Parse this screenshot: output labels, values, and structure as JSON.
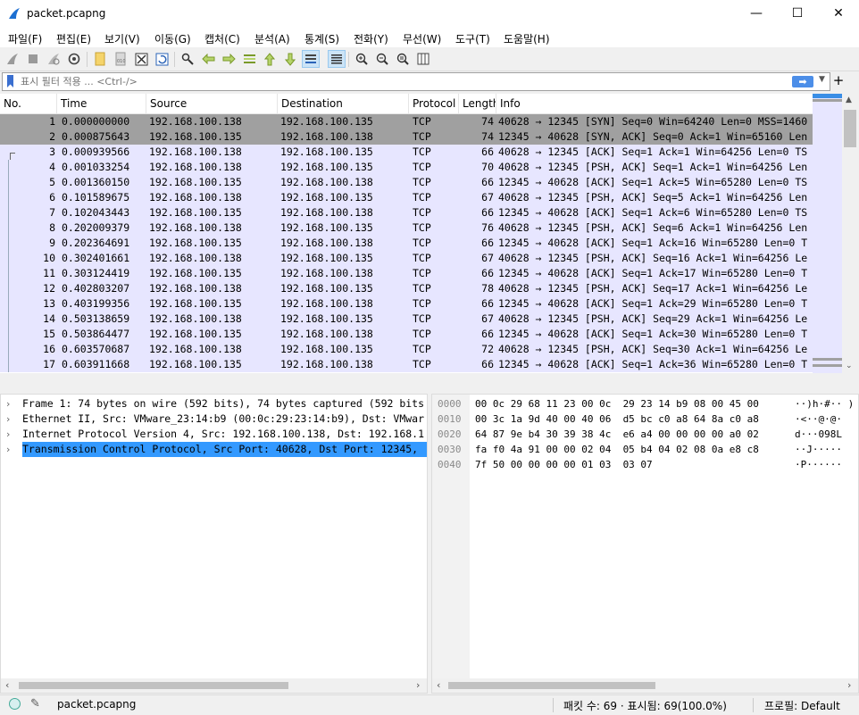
{
  "window": {
    "title": "packet.pcapng",
    "controls": {
      "minimize": "—",
      "maximize": "☐",
      "close": "✕"
    }
  },
  "menu": [
    "파일(F)",
    "편집(E)",
    "보기(V)",
    "이동(G)",
    "캡처(C)",
    "분석(A)",
    "통계(S)",
    "전화(Y)",
    "무선(W)",
    "도구(T)",
    "도움말(H)"
  ],
  "filter": {
    "placeholder": "표시 필터 적용 ... <Ctrl-/>",
    "apply_label": "➡",
    "add_label": "+"
  },
  "columns": [
    "No.",
    "Time",
    "Source",
    "Destination",
    "Protocol",
    "Length",
    "Info"
  ],
  "packets": [
    {
      "no": "1",
      "time": "0.000000000",
      "src": "192.168.100.138",
      "dst": "192.168.100.135",
      "proto": "TCP",
      "len": "74",
      "info": "40628 → 12345 [SYN] Seq=0 Win=64240 Len=0 MSS=1460",
      "style": "dark"
    },
    {
      "no": "2",
      "time": "0.000875643",
      "src": "192.168.100.135",
      "dst": "192.168.100.138",
      "proto": "TCP",
      "len": "74",
      "info": "12345 → 40628 [SYN, ACK] Seq=0 Ack=1 Win=65160 Len",
      "style": "dark"
    },
    {
      "no": "3",
      "time": "0.000939566",
      "src": "192.168.100.138",
      "dst": "192.168.100.135",
      "proto": "TCP",
      "len": "66",
      "info": "40628 → 12345 [ACK] Seq=1 Ack=1 Win=64256 Len=0 TS",
      "style": "normal"
    },
    {
      "no": "4",
      "time": "0.001033254",
      "src": "192.168.100.138",
      "dst": "192.168.100.135",
      "proto": "TCP",
      "len": "70",
      "info": "40628 → 12345 [PSH, ACK] Seq=1 Ack=1 Win=64256 Len",
      "style": "normal"
    },
    {
      "no": "5",
      "time": "0.001360150",
      "src": "192.168.100.135",
      "dst": "192.168.100.138",
      "proto": "TCP",
      "len": "66",
      "info": "12345 → 40628 [ACK] Seq=1 Ack=5 Win=65280 Len=0 TS",
      "style": "normal"
    },
    {
      "no": "6",
      "time": "0.101589675",
      "src": "192.168.100.138",
      "dst": "192.168.100.135",
      "proto": "TCP",
      "len": "67",
      "info": "40628 → 12345 [PSH, ACK] Seq=5 Ack=1 Win=64256 Len",
      "style": "normal"
    },
    {
      "no": "7",
      "time": "0.102043443",
      "src": "192.168.100.135",
      "dst": "192.168.100.138",
      "proto": "TCP",
      "len": "66",
      "info": "12345 → 40628 [ACK] Seq=1 Ack=6 Win=65280 Len=0 TS",
      "style": "normal"
    },
    {
      "no": "8",
      "time": "0.202009379",
      "src": "192.168.100.138",
      "dst": "192.168.100.135",
      "proto": "TCP",
      "len": "76",
      "info": "40628 → 12345 [PSH, ACK] Seq=6 Ack=1 Win=64256 Len",
      "style": "normal"
    },
    {
      "no": "9",
      "time": "0.202364691",
      "src": "192.168.100.135",
      "dst": "192.168.100.138",
      "proto": "TCP",
      "len": "66",
      "info": "12345 → 40628 [ACK] Seq=1 Ack=16 Win=65280 Len=0 T",
      "style": "normal"
    },
    {
      "no": "10",
      "time": "0.302401661",
      "src": "192.168.100.138",
      "dst": "192.168.100.135",
      "proto": "TCP",
      "len": "67",
      "info": "40628 → 12345 [PSH, ACK] Seq=16 Ack=1 Win=64256 Le",
      "style": "normal"
    },
    {
      "no": "11",
      "time": "0.303124419",
      "src": "192.168.100.135",
      "dst": "192.168.100.138",
      "proto": "TCP",
      "len": "66",
      "info": "12345 → 40628 [ACK] Seq=1 Ack=17 Win=65280 Len=0 T",
      "style": "normal"
    },
    {
      "no": "12",
      "time": "0.402803207",
      "src": "192.168.100.138",
      "dst": "192.168.100.135",
      "proto": "TCP",
      "len": "78",
      "info": "40628 → 12345 [PSH, ACK] Seq=17 Ack=1 Win=64256 Le",
      "style": "normal"
    },
    {
      "no": "13",
      "time": "0.403199356",
      "src": "192.168.100.135",
      "dst": "192.168.100.138",
      "proto": "TCP",
      "len": "66",
      "info": "12345 → 40628 [ACK] Seq=1 Ack=29 Win=65280 Len=0 T",
      "style": "normal"
    },
    {
      "no": "14",
      "time": "0.503138659",
      "src": "192.168.100.138",
      "dst": "192.168.100.135",
      "proto": "TCP",
      "len": "67",
      "info": "40628 → 12345 [PSH, ACK] Seq=29 Ack=1 Win=64256 Le",
      "style": "normal"
    },
    {
      "no": "15",
      "time": "0.503864477",
      "src": "192.168.100.135",
      "dst": "192.168.100.138",
      "proto": "TCP",
      "len": "66",
      "info": "12345 → 40628 [ACK] Seq=1 Ack=30 Win=65280 Len=0 T",
      "style": "normal"
    },
    {
      "no": "16",
      "time": "0.603570687",
      "src": "192.168.100.138",
      "dst": "192.168.100.135",
      "proto": "TCP",
      "len": "72",
      "info": "40628 → 12345 [PSH, ACK] Seq=30 Ack=1 Win=64256 Le",
      "style": "normal"
    },
    {
      "no": "17",
      "time": "0.603911668",
      "src": "192.168.100.135",
      "dst": "192.168.100.138",
      "proto": "TCP",
      "len": "66",
      "info": "12345 → 40628 [ACK] Seq=1 Ack=36 Win=65280 Len=0 T",
      "style": "normal"
    }
  ],
  "details": [
    {
      "text": "Frame 1: 74 bytes on wire (592 bits), 74 bytes captured (592 bits",
      "selected": false
    },
    {
      "text": "Ethernet II, Src: VMware_23:14:b9 (00:0c:29:23:14:b9), Dst: VMwar",
      "selected": false
    },
    {
      "text": "Internet Protocol Version 4, Src: 192.168.100.138, Dst: 192.168.1",
      "selected": false
    },
    {
      "text": "Transmission Control Protocol, Src Port: 40628, Dst Port: 12345,",
      "selected": true
    }
  ],
  "bytes": [
    {
      "offset": "0000",
      "hex": "00 0c 29 68 11 23 00 0c  29 23 14 b9 08 00 45 00",
      "ascii": "··)h·#·· )"
    },
    {
      "offset": "0010",
      "hex": "00 3c 1a 9d 40 00 40 06  d5 bc c0 a8 64 8a c0 a8",
      "ascii": "·<··@·@·"
    },
    {
      "offset": "0020",
      "hex": "64 87 9e b4 30 39 38 4c  e6 a4 00 00 00 00 a0 02",
      "ascii": "d···098L"
    },
    {
      "offset": "0030",
      "hex": "fa f0 4a 91 00 00 02 04  05 b4 04 02 08 0a e8 c8",
      "ascii": "··J·····"
    },
    {
      "offset": "0040",
      "hex": "7f 50 00 00 00 00 01 03  03 07",
      "ascii": "·P······"
    }
  ],
  "status": {
    "file": "packet.pcapng",
    "stats": "패킷 수: 69 · 표시됨: 69(100.0%)",
    "profile": "프로필: Default"
  },
  "toolbar_icons": [
    "shark-fin-start-icon",
    "stop-icon",
    "restart-icon",
    "options-gear-icon",
    "open-file-icon",
    "save-file-icon",
    "close-file-icon",
    "reload-icon",
    "find-packet-icon",
    "go-back-icon",
    "go-forward-icon",
    "go-to-packet-icon",
    "go-first-icon",
    "go-last-icon",
    "autoscroll-icon",
    "colorize-icon",
    "zoom-in-icon",
    "zoom-out-icon",
    "zoom-normal-icon",
    "resize-columns-icon"
  ]
}
